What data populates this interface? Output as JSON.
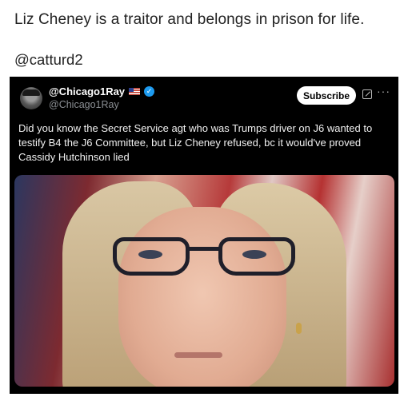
{
  "post": {
    "caption": "Liz Cheney is a traitor and belongs in prison for life.",
    "handle": "@catturd2"
  },
  "embedded_tweet": {
    "display_name": "@Chicago1Ray",
    "username": "@Chicago1Ray",
    "flag_icon": "us-flag-icon",
    "verified_icon": "verified-badge-icon",
    "subscribe_label": "Subscribe",
    "more_label": "···",
    "text": "Did you know the Secret Service agt who was Trumps driver on J6 wanted to testify B4 the J6 Committee, but Liz Cheney refused, bc it would've proved Cassidy Hutchinson lied"
  },
  "colors": {
    "background": "#ffffff",
    "card": "#000000",
    "verified": "#1d9bf0"
  }
}
